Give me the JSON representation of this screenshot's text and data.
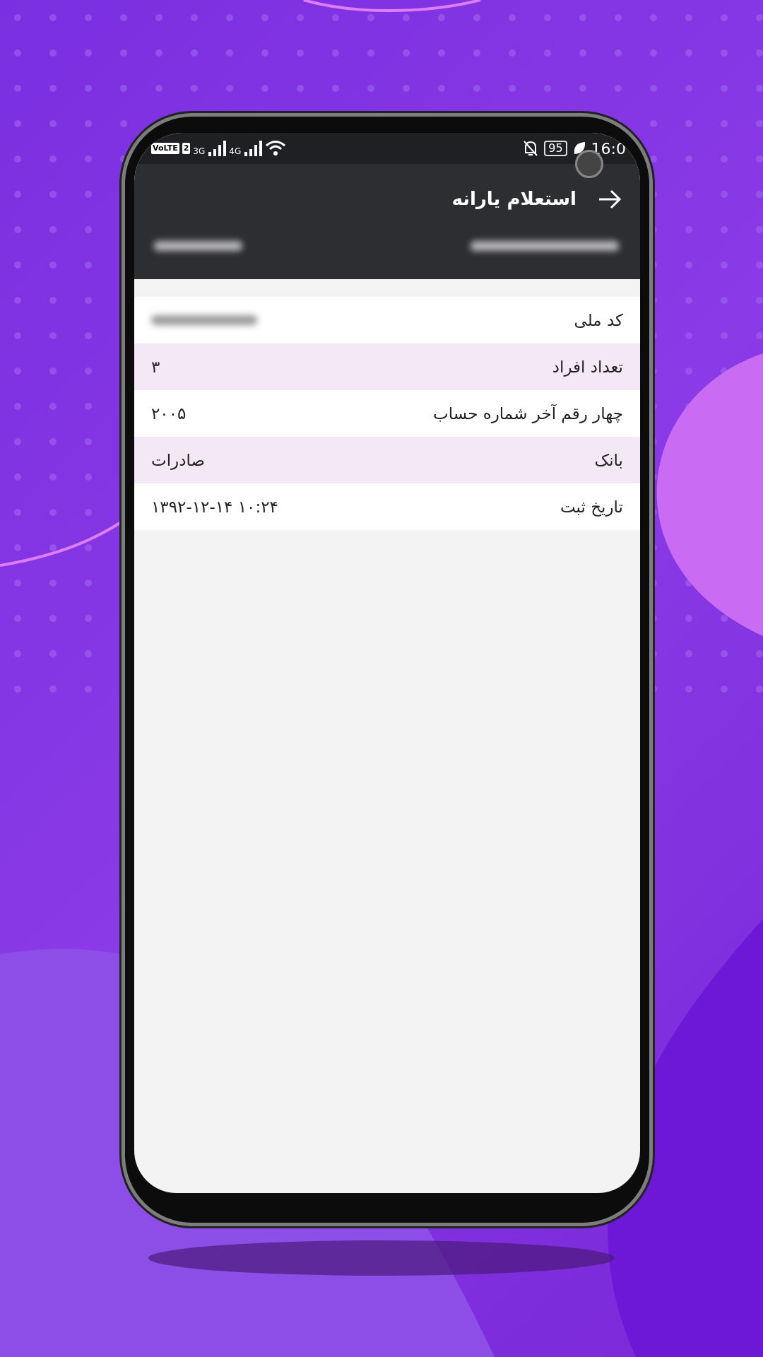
{
  "status_bar": {
    "carrier_badge": "VoLTE",
    "sim": "2",
    "sim1_network": "3G",
    "sim2_network": "4G",
    "battery": "95",
    "time": "16:0"
  },
  "header": {
    "title": "استعلام یارانه"
  },
  "rows": [
    {
      "label": "کد ملی",
      "blurred": true
    },
    {
      "label": "تعداد افراد",
      "value": "۳",
      "blurred": false
    },
    {
      "label": "چهار رقم آخر شماره حساب",
      "value": "۲۰۰۵",
      "blurred": false
    },
    {
      "label": "بانک",
      "value": "صادرات",
      "blurred": false
    },
    {
      "label": "تاریخ ثبت",
      "value": "۱۳۹۲-۱۲-۱۴ ۱۰:۲۴",
      "blurred": false
    }
  ]
}
